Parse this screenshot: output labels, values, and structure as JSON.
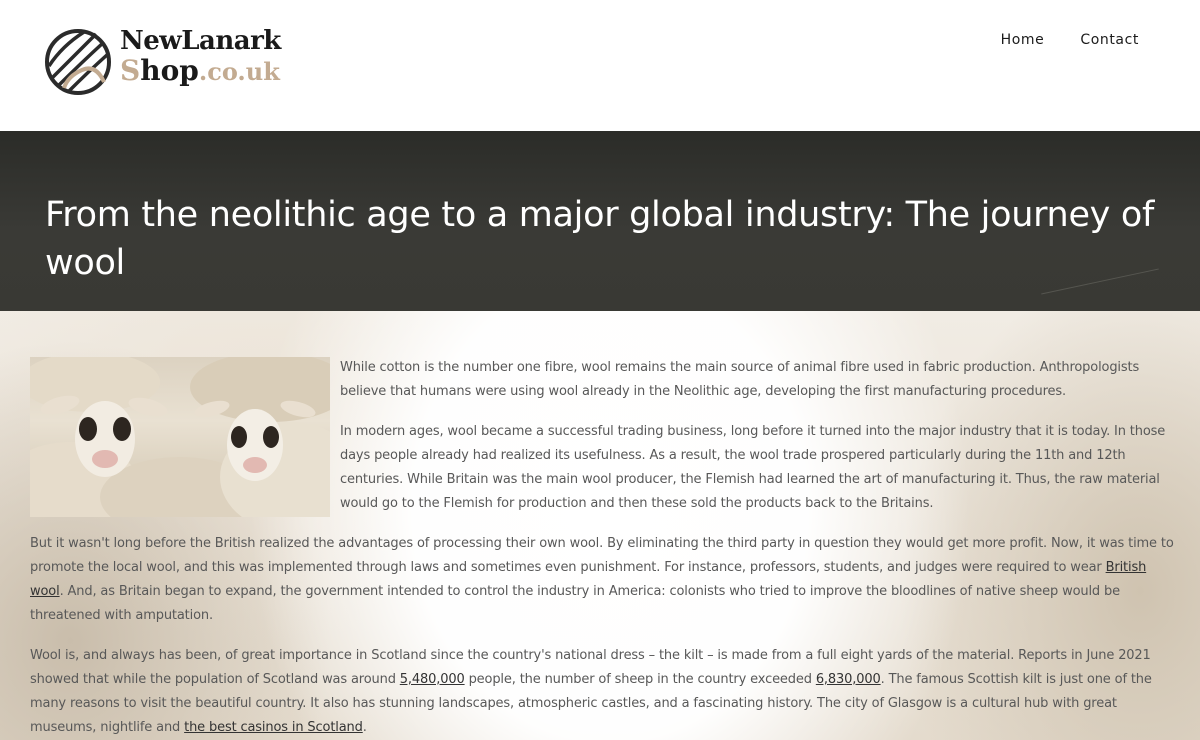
{
  "header": {
    "logo": {
      "line1": "NewLanark",
      "line2_s": "S",
      "line2_hop": "hop",
      "line2_tld": ".co.uk"
    },
    "nav": [
      {
        "label": "Home"
      },
      {
        "label": "Contact"
      }
    ]
  },
  "hero": {
    "title": "From the neolithic age to a major global industry: The journey of wool"
  },
  "article": {
    "p1": "While cotton is the number one fibre, wool remains the main source of animal fibre used in fabric production. Anthropologists believe that humans were using wool already in the Neolithic age, developing the first manufacturing procedures.",
    "p2": "In modern ages, wool became a successful trading business, long before it turned into the major industry that it is today. In those days people already had realized its usefulness. As a result, the wool trade prospered particularly during the 11th and 12th centuries. While Britain was the main wool producer, the Flemish had learned the art of manufacturing it. Thus, the raw material would go to the Flemish for production and then these sold the products back to the Britains.",
    "p3_a": "But it wasn't long before the British realized the advantages of processing their own wool. By eliminating the third party in question they would get more profit. Now, it was time to promote the local wool, and this was implemented through laws and sometimes even punishment. For instance, professors, students, and judges were required to wear ",
    "p3_link": "British wool",
    "p3_b": ". And, as Britain began to expand, the government intended to control the industry in America: colonists who tried to improve the bloodlines of native sheep would be threatened with amputation.",
    "p4_a": "Wool is, and always has been, of great importance in Scotland since the country's national dress – the kilt – is made from a full eight yards of the material. Reports in June 2021 showed that while the population of Scotland was around ",
    "p4_link1": "5,480,000",
    "p4_b": " people, the number of sheep in the country exceeded ",
    "p4_link2": "6,830,000",
    "p4_c": ". The famous Scottish kilt is just one of the many reasons to visit the beautiful country. It also has stunning landscapes, atmospheric castles, and a fascinating history. The city of Glasgow is a cultural hub with great museums, nightlife and ",
    "p4_link3": "the best casinos in Scotland",
    "p4_d": "."
  }
}
